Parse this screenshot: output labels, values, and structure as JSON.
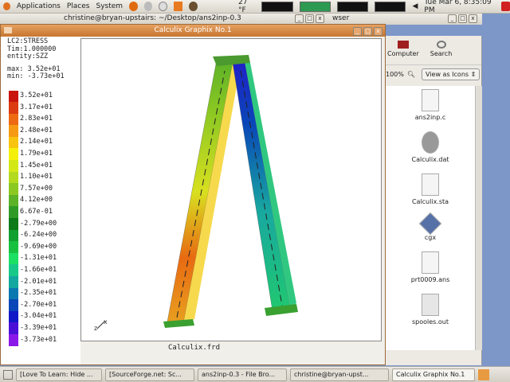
{
  "top_panel": {
    "menus": [
      "Applications",
      "Places",
      "System"
    ],
    "weather": "27 °F",
    "clock": "Tue Mar  6,  8:35:09 PM"
  },
  "terminal": {
    "title": "christine@bryan-upstairs: ~/Desktop/ans2inp-0.3"
  },
  "file_browser": {
    "title_fragment": "wser",
    "toolbar": [
      "Computer",
      "Search"
    ],
    "zoom": "100%",
    "view_mode": "View as Icons",
    "files": [
      "ans2inp.c",
      "Calculix.dat",
      "Calculix.sta",
      "cgx",
      "prt0009.ans",
      "spooles.out"
    ]
  },
  "calculix": {
    "title": "Calculix Graphix No.1",
    "info": [
      "LC2:STRESS",
      "Tim:1.000000",
      "entity:SZZ"
    ],
    "max": "max: 3.52e+01",
    "min": "min: -3.73e+01",
    "filename": "Calculix.frd",
    "legend": [
      {
        "v": "3.52e+01",
        "c": "#c8140c"
      },
      {
        "v": "3.17e+01",
        "c": "#dc3a10"
      },
      {
        "v": "2.83e+01",
        "c": "#ee6a12"
      },
      {
        "v": "2.48e+01",
        "c": "#f59a12"
      },
      {
        "v": "2.14e+01",
        "c": "#f8c40e"
      },
      {
        "v": "1.79e+01",
        "c": "#f5f00a"
      },
      {
        "v": "1.45e+01",
        "c": "#d4e816"
      },
      {
        "v": "1.10e+01",
        "c": "#b4da1e"
      },
      {
        "v": "7.57e+00",
        "c": "#8cc822"
      },
      {
        "v": "4.12e+00",
        "c": "#5cb228"
      },
      {
        "v": "6.67e-01",
        "c": "#2f9a28"
      },
      {
        "v": "-2.79e+00",
        "c": "#0c7a18"
      },
      {
        "v": "-6.24e+00",
        "c": "#10a030"
      },
      {
        "v": "-9.69e+00",
        "c": "#18c040"
      },
      {
        "v": "-1.31e+01",
        "c": "#1ce064"
      },
      {
        "v": "-1.66e+01",
        "c": "#18c888"
      },
      {
        "v": "-2.01e+01",
        "c": "#12a8a0"
      },
      {
        "v": "-2.35e+01",
        "c": "#0a78b0"
      },
      {
        "v": "-2.70e+01",
        "c": "#0a46b8"
      },
      {
        "v": "-3.04e+01",
        "c": "#1018c8"
      },
      {
        "v": "-3.39e+01",
        "c": "#4a10d8"
      },
      {
        "v": "-3.73e+01",
        "c": "#8a18e8"
      }
    ]
  },
  "taskbar": [
    "[Love To Learn: Hide ...",
    "[SourceForge.net: Sc...",
    "ans2inp-0.3 - File Bro...",
    "christine@bryan-upst...",
    "Calculix Graphix No.1"
  ]
}
